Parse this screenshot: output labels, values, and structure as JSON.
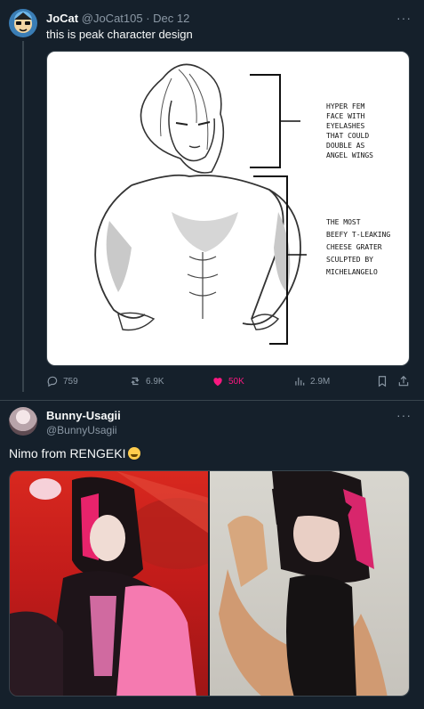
{
  "tweet1": {
    "author_name": "JoCat",
    "author_handle": "@JoCat105",
    "separator": " · ",
    "date": "Dec 12",
    "text": "this is peak character design",
    "image": {
      "annotation_top_lines": [
        "HYPER FEM",
        "FACE WITH",
        "EYELASHES",
        "THAT COULD",
        "DOUBLE AS",
        "ANGEL WINGS"
      ],
      "annotation_bottom_lines": [
        "THE MOST",
        "BEEFY T-LEAKING",
        "CHEESE GRATER",
        "SCULPTED BY",
        "MICHELANGELO"
      ]
    },
    "stats": {
      "replies": "759",
      "reposts": "6.9K",
      "likes": "50K",
      "views": "2.9M"
    }
  },
  "tweet2": {
    "author_name": "Bunny-Usagii",
    "author_handle": "@BunnyUsagii",
    "text": "Nimo from RENGEKI"
  },
  "icons": {
    "reply": "reply-icon",
    "repost": "repost-icon",
    "like": "heart-icon",
    "views": "views-icon",
    "bookmark": "bookmark-icon",
    "share": "share-icon",
    "more": "more-icon",
    "emoji": "rofl-emoji-icon"
  },
  "colors": {
    "background": "#15202b",
    "like_active": "#f91880",
    "muted": "#8b98a5",
    "border": "#38444d"
  }
}
